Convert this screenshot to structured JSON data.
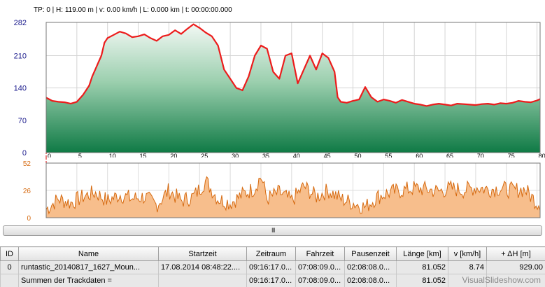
{
  "status_line": "TP: 0 | H: 119.00 m | v: 0.00 km/h | L: 0.000 km | t: 00:00:00.000",
  "splitter": {
    "grip": "III"
  },
  "watermark": "VisualSlideshow.com",
  "colors": {
    "elevation_line": "#ec1c1c",
    "elevation_fill_top": "#f2f8f4",
    "elevation_fill_bottom": "#0f7a45",
    "speed_fill": "#f7be8c",
    "speed_line": "#d66a10",
    "axis_label": "#1a1a8c"
  },
  "table": {
    "columns": [
      "ID",
      "Name",
      "Startzeit",
      "Zeitraum",
      "Fahrzeit",
      "Pausenzeit",
      "Länge  [km]",
      "v  [km/h]",
      "+ ΔH  [m]"
    ],
    "rows": [
      [
        "0",
        "runtastic_20140817_1627_Moun...",
        "17.08.2014 08:48:22....",
        "09:16:17.0...",
        "07:08:09.0...",
        "02:08:08.0...",
        "81.052",
        "8.74",
        "929.00"
      ],
      [
        "",
        "Summen der Trackdaten =",
        "",
        "09:16:17.0...",
        "07:08:09.0...",
        "02:08:08.0...",
        "81.052",
        "",
        ""
      ]
    ]
  },
  "chart_data": [
    {
      "type": "area",
      "x_ticks": [
        0,
        5,
        10,
        15,
        20,
        25,
        30,
        35,
        40,
        45,
        50,
        55,
        60,
        65,
        70,
        75,
        80
      ],
      "y_ticks": [
        0,
        70,
        140,
        210,
        282
      ],
      "xlim": [
        0,
        80.5
      ],
      "ylim": [
        0,
        282
      ],
      "grid": true,
      "cursor_x": 0,
      "x": [
        0,
        1,
        2,
        3,
        4,
        5,
        6,
        7,
        7.5,
        8,
        8.5,
        9,
        9.5,
        10,
        11,
        12,
        13,
        14,
        15,
        16,
        17,
        18,
        19,
        20,
        21,
        22,
        23,
        24,
        25,
        26,
        27,
        28,
        29,
        30,
        31,
        32,
        33,
        34,
        35,
        36,
        37,
        38,
        39,
        40,
        41,
        42,
        43,
        44,
        45,
        46,
        47,
        47.5,
        48,
        49,
        50,
        51,
        52,
        53,
        54,
        55,
        56,
        57,
        58,
        59,
        60,
        61,
        62,
        63,
        64,
        65,
        66,
        67,
        68,
        69,
        70,
        71,
        72,
        73,
        74,
        75,
        76,
        77,
        78,
        79,
        80,
        80.5
      ],
      "values": [
        119,
        112,
        110,
        109,
        106,
        110,
        125,
        145,
        165,
        180,
        195,
        210,
        238,
        248,
        255,
        262,
        258,
        250,
        252,
        256,
        248,
        242,
        252,
        255,
        265,
        257,
        268,
        278,
        270,
        260,
        252,
        232,
        180,
        160,
        140,
        135,
        165,
        210,
        232,
        225,
        175,
        160,
        210,
        215,
        150,
        180,
        210,
        180,
        215,
        205,
        175,
        120,
        110,
        108,
        112,
        115,
        142,
        120,
        110,
        115,
        112,
        108,
        114,
        110,
        106,
        104,
        101,
        104,
        106,
        104,
        102,
        106,
        105,
        104,
        103,
        105,
        106,
        104,
        107,
        106,
        108,
        112,
        110,
        109,
        113,
        116
      ]
    },
    {
      "type": "area",
      "y_ticks": [
        0,
        26,
        52
      ],
      "xlim": [
        0,
        80.5
      ],
      "ylim": [
        0,
        52
      ],
      "grid": true,
      "x": [
        0,
        2,
        4,
        6,
        8,
        10,
        12,
        14,
        16,
        18,
        20,
        22,
        24,
        26,
        28,
        30,
        32,
        34,
        35,
        36,
        38,
        40,
        42,
        44,
        46,
        48,
        50,
        52,
        54,
        56,
        58,
        60,
        62,
        64,
        66,
        68,
        70,
        72,
        74,
        76,
        78,
        80
      ],
      "values": [
        8,
        18,
        14,
        20,
        24,
        16,
        22,
        18,
        20,
        12,
        26,
        16,
        20,
        35,
        18,
        14,
        22,
        28,
        40,
        18,
        24,
        16,
        30,
        20,
        26,
        18,
        14,
        10,
        20,
        24,
        26,
        28,
        27,
        25,
        28,
        26,
        29,
        27,
        28,
        26,
        27,
        14
      ]
    }
  ]
}
